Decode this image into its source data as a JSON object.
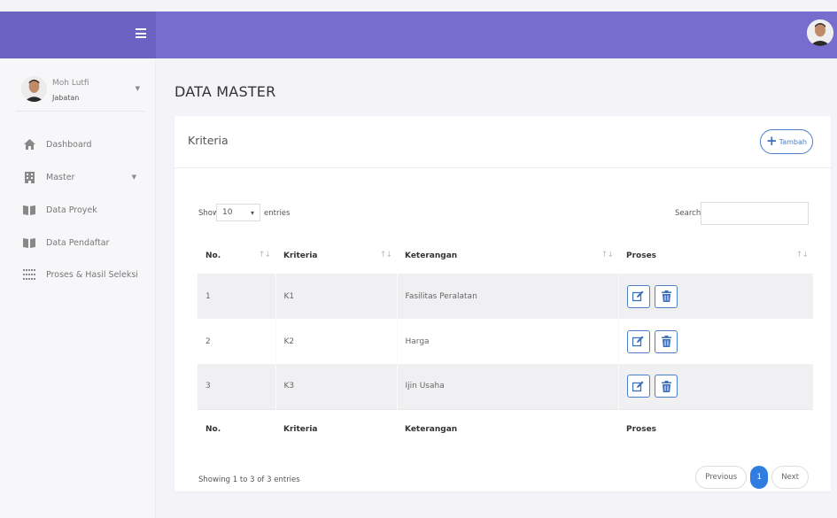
{
  "colors": {
    "header": "#766dcf",
    "brand": "#6a61c0",
    "accent": "#4c7ec9",
    "pagination_active": "#2f7de1"
  },
  "user": {
    "name": "Moh Lutfi",
    "role": "Jabatan"
  },
  "sidebar": {
    "items": [
      {
        "label": "Dashboard",
        "icon": "home-icon"
      },
      {
        "label": "Master",
        "icon": "building-icon",
        "has_caret": true
      },
      {
        "label": "Data Proyek",
        "icon": "book-icon"
      },
      {
        "label": "Data Pendaftar",
        "icon": "book-icon"
      },
      {
        "label": "Proses & Hasil Seleksi",
        "icon": "grid-icon"
      }
    ]
  },
  "page": {
    "title": "DATA MASTER"
  },
  "card": {
    "title": "Kriteria",
    "add_label": "Tambah"
  },
  "table": {
    "length_pre": "Show",
    "length_value": "10",
    "length_post": "entries",
    "search_label": "Search:",
    "columns": [
      "No.",
      "Kriteria",
      "Keterangan",
      "Proses"
    ],
    "rows": [
      {
        "no": "1",
        "kriteria": "K1",
        "keterangan": "Fasilitas Peralatan"
      },
      {
        "no": "2",
        "kriteria": "K2",
        "keterangan": "Harga"
      },
      {
        "no": "3",
        "kriteria": "K3",
        "keterangan": "Ijin Usaha"
      }
    ],
    "info": "Showing 1 to 3 of 3 entries",
    "pagination": {
      "previous": "Previous",
      "current": "1",
      "next": "Next"
    }
  }
}
